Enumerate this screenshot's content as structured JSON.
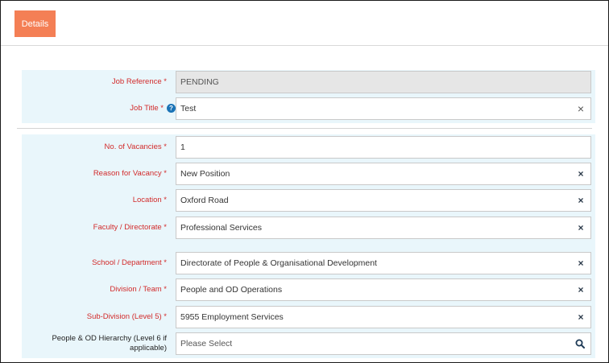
{
  "tabs": {
    "details_label": "Details"
  },
  "form": {
    "job_reference": {
      "label": "Job Reference *",
      "value": "PENDING"
    },
    "job_title": {
      "label": "Job Title *",
      "help_icon": "?",
      "value": "Test"
    },
    "vacancies": {
      "label": "No. of Vacancies *",
      "value": "1"
    },
    "reason": {
      "label": "Reason for Vacancy *",
      "value": "New Position"
    },
    "location": {
      "label": "Location *",
      "value": "Oxford Road"
    },
    "faculty": {
      "label": "Faculty / Directorate *",
      "value": "Professional Services"
    },
    "school": {
      "label": "School / Department *",
      "value": "Directorate of People & Organisational Development"
    },
    "division": {
      "label": "Division / Team *",
      "value": "People and OD Operations"
    },
    "subdivision": {
      "label": "Sub-Division (Level 5) *",
      "value": "5955 Employment Services"
    },
    "hierarchy": {
      "label_line1": "People & OD Hierarchy (Level 6 if",
      "label_line2": "applicable)",
      "placeholder": "Please Select"
    }
  },
  "icons": {
    "clear": "×",
    "search": "search-icon",
    "help": "help-icon"
  },
  "colors": {
    "accent": "#f47f55",
    "required_label": "#d22b2b",
    "section_bg": "#e9f6fb",
    "help_icon": "#1a73b6"
  }
}
